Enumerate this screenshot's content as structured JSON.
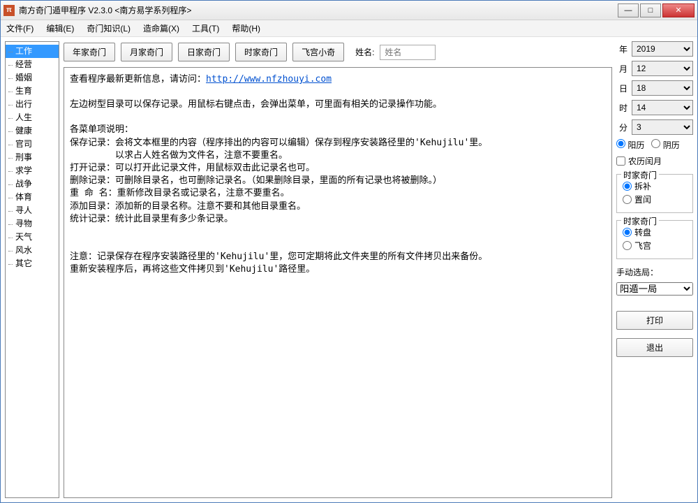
{
  "title": "南方奇门遁甲程序 V2.3.0   <南方易学系列程序>",
  "menu": {
    "file": "文件(F)",
    "edit": "编辑(E)",
    "qimen": "奇门知识(L)",
    "zaoming": "造命篇(X)",
    "tools": "工具(T)",
    "help": "帮助(H)"
  },
  "sidebar": {
    "items": [
      "工作",
      "经营",
      "婚姻",
      "生育",
      "出行",
      "人生",
      "健康",
      "官司",
      "刑事",
      "求学",
      "战争",
      "体育",
      "寻人",
      "寻物",
      "天气",
      "风水",
      "其它"
    ],
    "selected": 0
  },
  "toolbar": {
    "btns": [
      "年家奇门",
      "月家奇门",
      "日家奇门",
      "时家奇门",
      "飞宫小奇"
    ],
    "name_label": "姓名:",
    "name_placeholder": "姓名"
  },
  "content": {
    "l1a": "查看程序最新更新信息，请访问：",
    "l1_link": "http://www.nfzhouyi.com",
    "l2": "左边树型目录可以保存记录。用鼠标右键点击，会弹出菜单，可里面有相关的记录操作功能。",
    "l3": "各菜单项说明：",
    "l4": "保存记录：会将文本框里的内容（程序排出的内容可以编辑）保存到程序安装路径里的'Kehujilu'里。",
    "l5": "　　　　　以求占人姓名做为文件名，注意不要重名。",
    "l6": "打开记录：可以打开此记录文件，用鼠标双击此记录名也可。",
    "l7": "删除记录：可删除目录名，也可删除记录名。（如果删除目录，里面的所有记录也将被删除。）",
    "l8": "重 命 名：重新修改目录名或记录名，注意不要重名。",
    "l9": "添加目录：添加新的目录名称。注意不要和其他目录重名。",
    "l10": "统计记录：统计此目录里有多少条记录。",
    "l11": "注意：记录保存在程序安装路径里的'Kehujilu'里，您可定期将此文件夹里的所有文件拷贝出来备份。",
    "l12": "重新安装程序后，再将这些文件拷贝到'Kehujilu'路径里。"
  },
  "right": {
    "year_l": "年",
    "year_v": "2019",
    "month_l": "月",
    "month_v": "12",
    "day_l": "日",
    "day_v": "18",
    "hour_l": "时",
    "hour_v": "14",
    "minute_l": "分",
    "minute_v": "3",
    "cal_yang": "阳历",
    "cal_yin": "阴历",
    "lunar_leap": "农历闰月",
    "group1_title": "时家奇门",
    "g1_opt1": "拆补",
    "g1_opt2": "置闰",
    "group2_title": "时家奇门",
    "g2_opt1": "转盘",
    "g2_opt2": "飞宫",
    "manual_label": "手动选局：",
    "manual_value": "阳遁一局",
    "print": "打印",
    "exit": "退出"
  }
}
